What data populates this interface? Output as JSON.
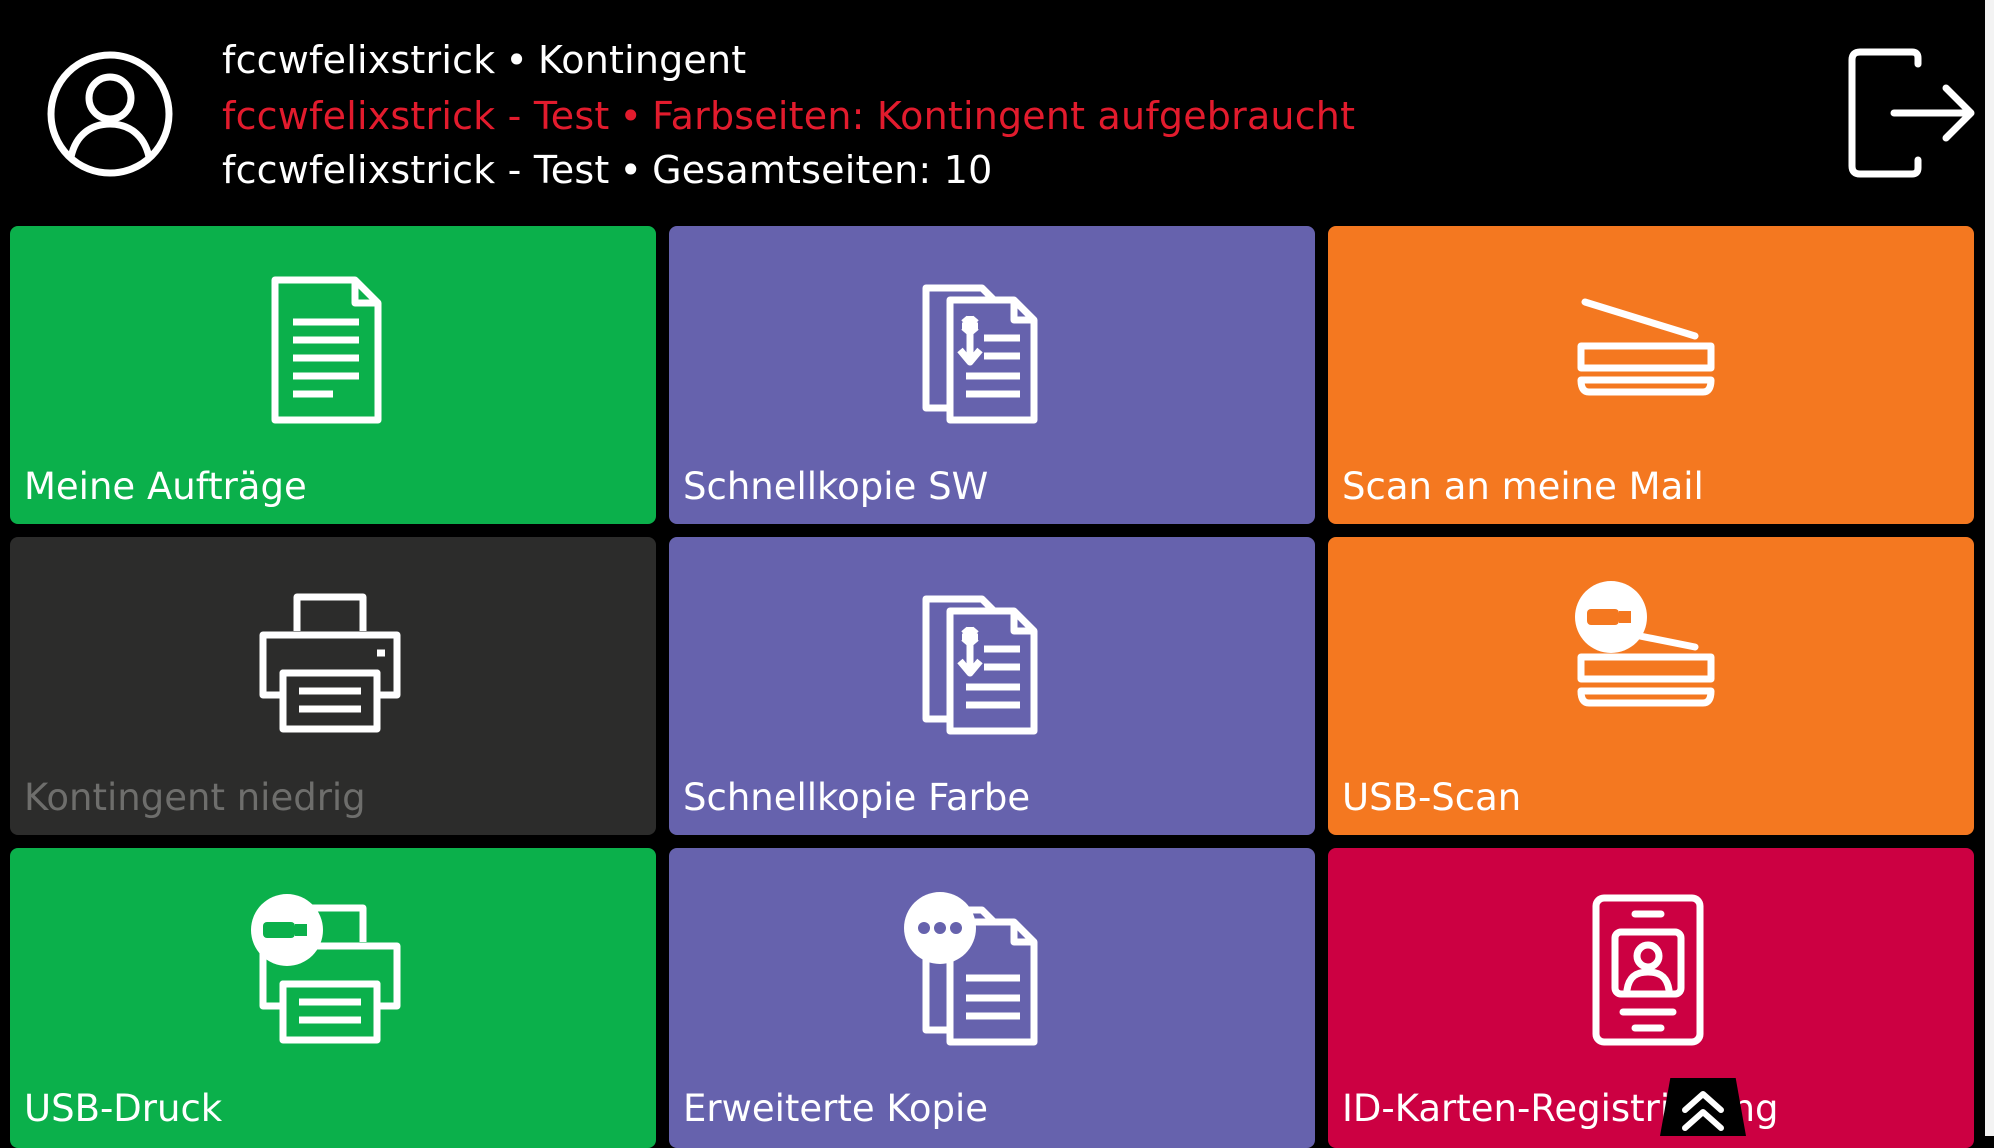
{
  "header": {
    "line1": {
      "user": "fccwfelixstrick",
      "separator": "•",
      "text": "Kontingent"
    },
    "line2": {
      "user": "fccwfelixstrick - Test",
      "separator": "•",
      "text": "Farbseiten: Kontingent aufgebraucht"
    },
    "line3": {
      "user": "fccwfelixstrick - Test",
      "separator": "•",
      "text": "Gesamtseiten: 10"
    }
  },
  "icons": {
    "avatar": "user-circle-icon",
    "logout": "logout-icon",
    "scroll": "double-chevron-up-icon"
  },
  "colors": {
    "green": "#0bb04b",
    "purple": "#6662ad",
    "orange": "#f47820",
    "dark": "#2c2c2b",
    "crimson": "#cc0042",
    "warning_text": "#e21b2d"
  },
  "tiles": [
    {
      "label": "Meine Aufträge",
      "icon": "document-icon",
      "color": "green"
    },
    {
      "label": "Schnellkopie SW",
      "icon": "copy-icon",
      "color": "purple"
    },
    {
      "label": "Scan an meine Mail",
      "icon": "scanner-icon",
      "color": "orange"
    },
    {
      "label": "Kontingent niedrig",
      "icon": "printer-icon",
      "color": "dark",
      "disabled": true
    },
    {
      "label": "Schnellkopie Farbe",
      "icon": "copy-icon",
      "color": "purple"
    },
    {
      "label": "USB-Scan",
      "icon": "usb-scan-icon",
      "color": "orange"
    },
    {
      "label": "USB-Druck",
      "icon": "usb-print-icon",
      "color": "green"
    },
    {
      "label": "Erweiterte Kopie",
      "icon": "advanced-copy-icon",
      "color": "purple"
    },
    {
      "label": "ID-Karten-Registrierung",
      "icon": "id-card-icon",
      "color": "crimson"
    }
  ]
}
